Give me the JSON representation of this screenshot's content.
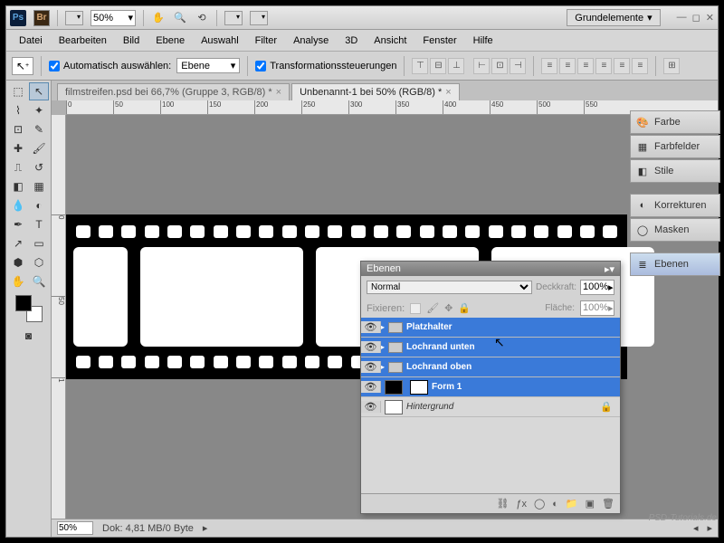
{
  "topbar": {
    "zoom": "50%",
    "workspace": "Grundelemente"
  },
  "menu": [
    "Datei",
    "Bearbeiten",
    "Bild",
    "Ebene",
    "Auswahl",
    "Filter",
    "Analyse",
    "3D",
    "Ansicht",
    "Fenster",
    "Hilfe"
  ],
  "options": {
    "auto_select": "Automatisch auswählen:",
    "target": "Ebene",
    "transform": "Transformationssteuerungen"
  },
  "tabs": [
    {
      "label": "filmstreifen.psd bei 66,7% (Gruppe 3, RGB/8) *",
      "active": false
    },
    {
      "label": "Unbenannt-1 bei 50% (RGB/8) *",
      "active": true
    }
  ],
  "ruler_h": [
    "0",
    "50",
    "100",
    "150",
    "200",
    "250",
    "300",
    "350",
    "400",
    "450",
    "500",
    "550"
  ],
  "ruler_v": [
    "0",
    "50",
    "1"
  ],
  "status": {
    "zoom": "50%",
    "doc": "Dok: 4,81 MB/0 Byte"
  },
  "panels": {
    "farbe": "Farbe",
    "farbfelder": "Farbfelder",
    "stile": "Stile",
    "korrekturen": "Korrekturen",
    "masken": "Masken",
    "ebenen": "Ebenen"
  },
  "layers_panel": {
    "title": "Ebenen",
    "blend": "Normal",
    "opacity_label": "Deckkraft:",
    "opacity": "100%",
    "lock_label": "Fixieren:",
    "fill_label": "Fläche:",
    "fill": "100%",
    "layers": [
      {
        "name": "Platzhalter",
        "type": "group",
        "selected": true
      },
      {
        "name": "Lochrand unten",
        "type": "group",
        "selected": true
      },
      {
        "name": "Lochrand oben",
        "type": "group",
        "selected": true
      },
      {
        "name": "Form 1",
        "type": "shape",
        "selected": true
      },
      {
        "name": "Hintergrund",
        "type": "bg",
        "selected": false
      }
    ]
  },
  "watermark": "PSD-Tutorials.de"
}
